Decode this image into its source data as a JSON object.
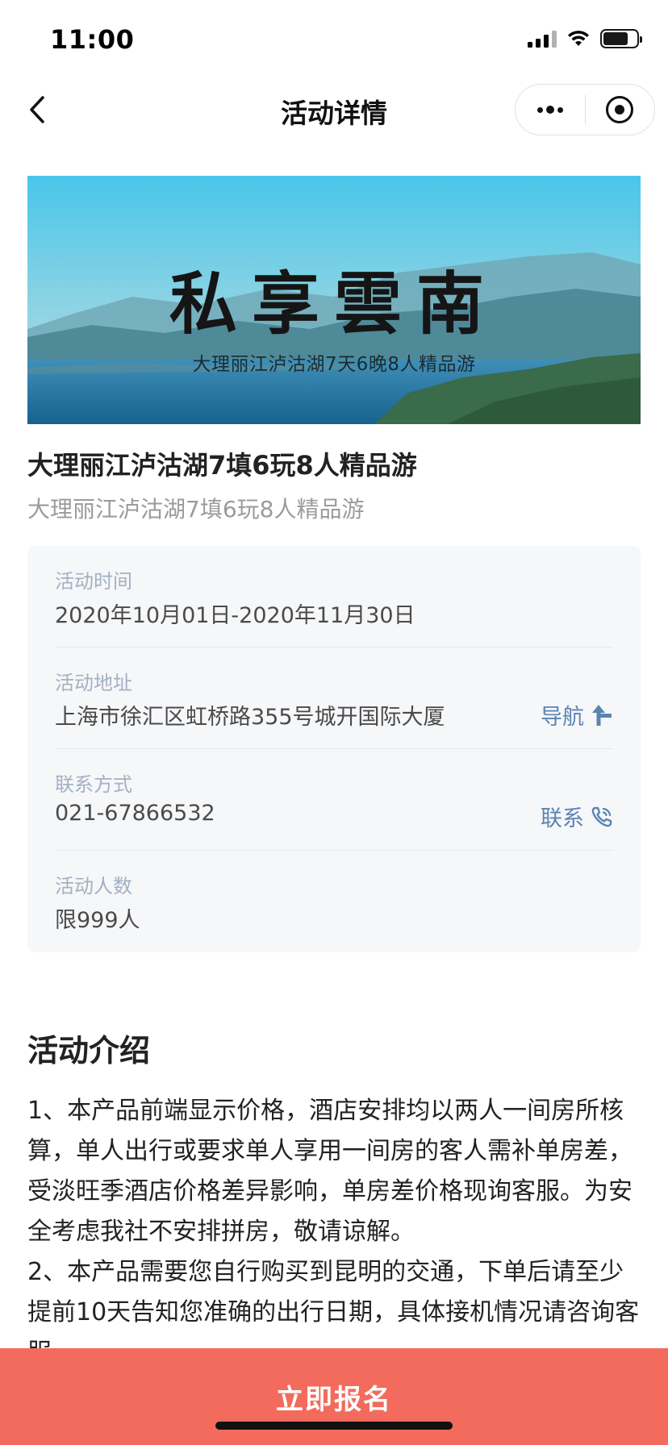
{
  "status_bar": {
    "time": "11:00"
  },
  "nav": {
    "title": "活动详情"
  },
  "banner": {
    "title": "私享雲南",
    "subtitle": "大理丽江泸沽湖7天6晚8人精品游"
  },
  "event": {
    "title": "大理丽江泸沽湖7填6玩8人精品游",
    "subtitle": "大理丽江泸沽湖7填6玩8人精品游"
  },
  "info": {
    "time": {
      "label": "活动时间",
      "value": "2020年10月01日-2020年11月30日"
    },
    "address": {
      "label": "活动地址",
      "value": "上海市徐汇区虹桥路355号城开国际大厦",
      "action": "导航"
    },
    "contact": {
      "label": "联系方式",
      "value": "021-67866532",
      "action": "联系"
    },
    "people": {
      "label": "活动人数",
      "value": "限999人"
    }
  },
  "intro": {
    "heading": "活动介绍",
    "paragraphs": [
      "1、本产品前端显示价格，酒店安排均以两人一间房所核算，单人出行或要求单人享用一间房的客人需补单房差，受淡旺季酒店价格差异影响，单房差价格现询客服。为安全考虑我社不安排拼房，敬请谅解。",
      "2、本产品需要您自行购买到昆明的交通，下单后请至少提前10天告知您准确的出行日期，具体接机情况请咨询客服。"
    ]
  },
  "cta": {
    "label": "立即报名"
  },
  "colors": {
    "cta": "#f26b5c",
    "link": "#5b84b3",
    "label": "#a3b1c3"
  }
}
